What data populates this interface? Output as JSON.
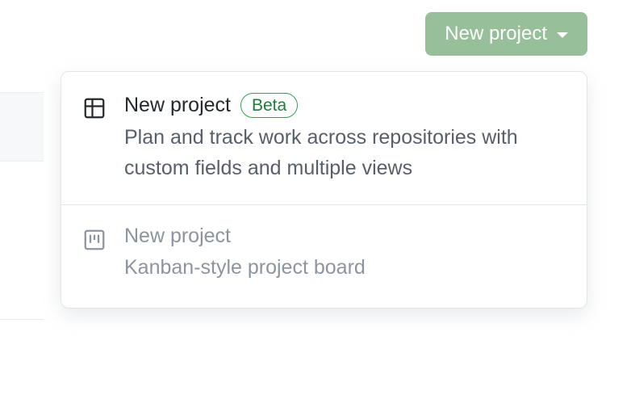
{
  "button": {
    "label": "New project"
  },
  "dropdown": {
    "items": [
      {
        "title": "New project",
        "badge": "Beta",
        "description": "Plan and track work across repositories with custom fields and multiple views"
      },
      {
        "title": "New project",
        "description": "Kanban-style project board"
      }
    ]
  }
}
